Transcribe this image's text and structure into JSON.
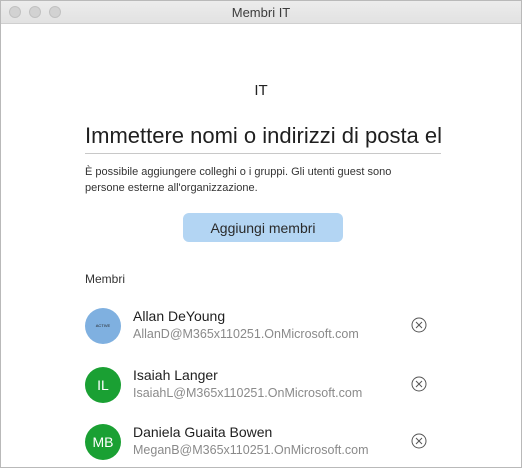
{
  "window": {
    "title": "Membri IT"
  },
  "group": {
    "name": "IT"
  },
  "search": {
    "placeholder": "Immettere nomi o indirizzi di posta elettronica"
  },
  "hint": "È possibile aggiungere colleghi o i gruppi. Gli utenti guest sono persone esterne all'organizzazione.",
  "add_button_label": "Aggiungi membri",
  "members_heading": "Membri",
  "colors": {
    "accent_button": "#b3d5f3",
    "avatar_green": "#1aa033",
    "avatar_photo": "#7fb0e0"
  },
  "members": [
    {
      "name": "Allan DeYoung",
      "email": "AllanD@M365x110251.OnMicrosoft.com",
      "avatar_text": "ACTIVE DIRECTORY",
      "avatar_type": "photo"
    },
    {
      "name": "Isaiah Langer",
      "email": "IsaiahL@M365x110251.OnMicrosoft.com",
      "avatar_text": "IL",
      "avatar_type": "initials"
    },
    {
      "name": "Daniela Guaita Bowen",
      "email": "MeganB@M365x110251.OnMicrosoft.com",
      "avatar_text": "MB",
      "avatar_type": "initials"
    }
  ]
}
